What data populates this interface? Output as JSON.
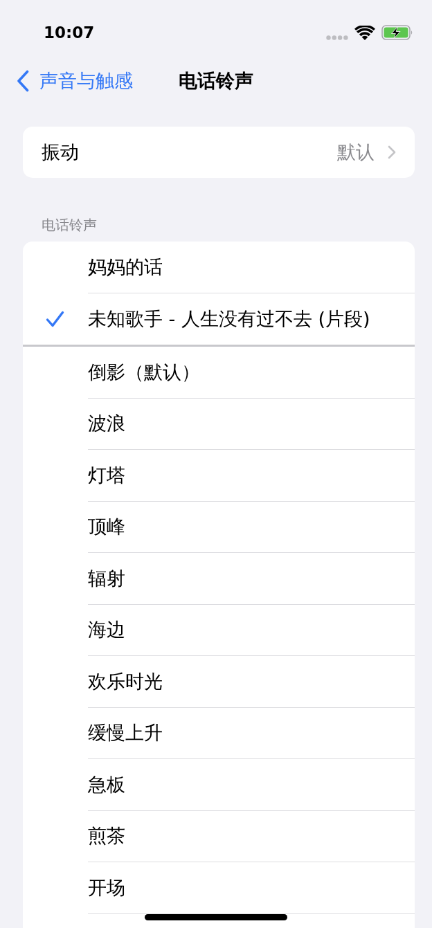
{
  "status_bar": {
    "time": "10:07",
    "battery_charging": true
  },
  "nav_bar": {
    "back_label": "声音与触感",
    "title": "电话铃声"
  },
  "vibration": {
    "label": "振动",
    "value": "默认"
  },
  "ringtones": {
    "header": "电话铃声",
    "groups": [
      {
        "items": [
          {
            "name": "妈妈的话",
            "selected": false
          },
          {
            "name": "未知歌手 - 人生没有过不去 (片段)",
            "selected": true
          }
        ]
      },
      {
        "items": [
          {
            "name": "倒影（默认）",
            "selected": false
          },
          {
            "name": "波浪",
            "selected": false
          },
          {
            "name": "灯塔",
            "selected": false
          },
          {
            "name": "顶峰",
            "selected": false
          },
          {
            "name": "辐射",
            "selected": false
          },
          {
            "name": "海边",
            "selected": false
          },
          {
            "name": "欢乐时光",
            "selected": false
          },
          {
            "name": "缓慢上升",
            "selected": false
          },
          {
            "name": "急板",
            "selected": false
          },
          {
            "name": "煎茶",
            "selected": false
          },
          {
            "name": "开场",
            "selected": false
          }
        ]
      }
    ]
  }
}
